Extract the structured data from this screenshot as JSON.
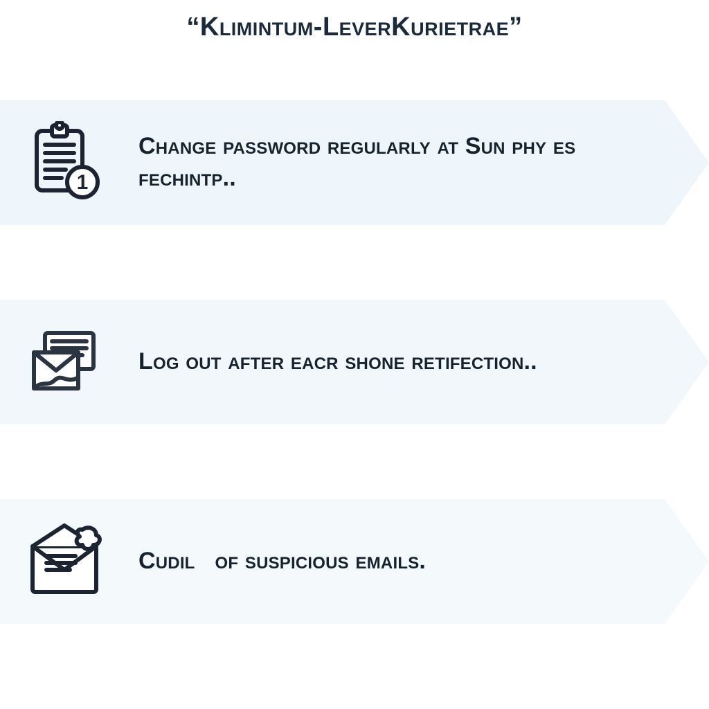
{
  "title": {
    "quoted": "Klimintum-LeverKurietrae"
  },
  "tips": [
    {
      "icon": "clipboard-number-1-icon",
      "text": "Change password regularly at Sun phy es fechintp.."
    },
    {
      "icon": "mail-document-icon",
      "text": "Log out after eacr shone retifection.."
    },
    {
      "icon": "suspicious-email-icon",
      "text": "Cudil   of suspicious emails."
    }
  ],
  "colors": {
    "banner": "#eef6fb",
    "text": "#16222e",
    "icon_stroke": "#1b2430"
  }
}
